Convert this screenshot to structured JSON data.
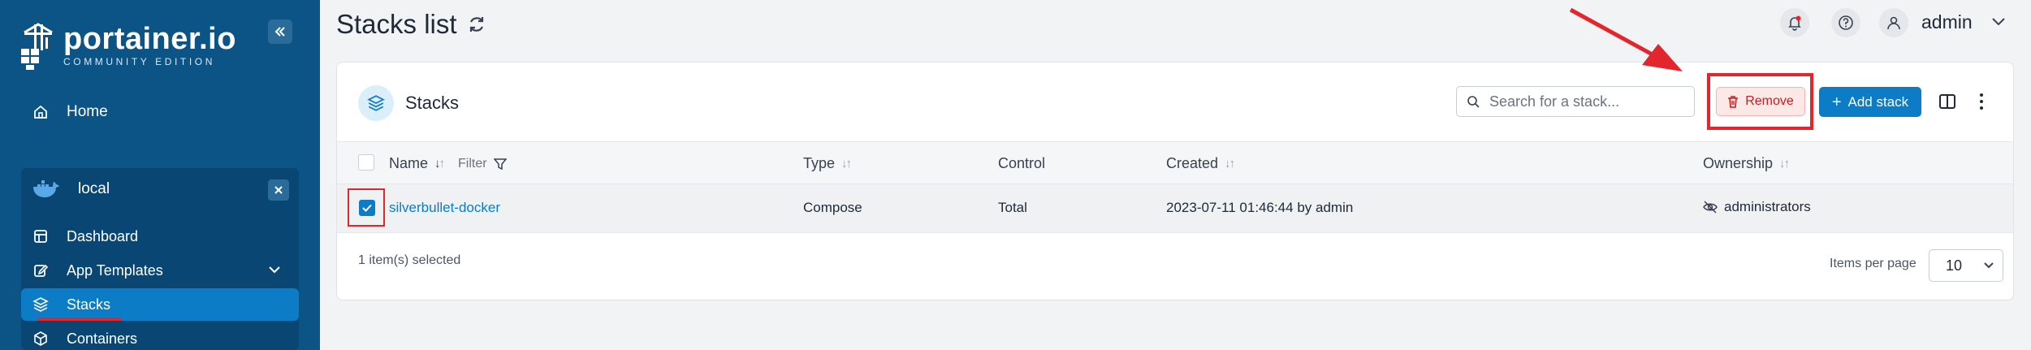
{
  "brand": {
    "name": "portainer.io",
    "edition": "COMMUNITY EDITION"
  },
  "sidebar": {
    "home_label": "Home",
    "environment": {
      "name": "local"
    },
    "items": [
      {
        "label": "Dashboard"
      },
      {
        "label": "App Templates"
      },
      {
        "label": "Stacks"
      },
      {
        "label": "Containers"
      }
    ]
  },
  "header": {
    "title": "Stacks list",
    "user": "admin"
  },
  "card": {
    "title": "Stacks",
    "search_placeholder": "Search for a stack...",
    "remove_label": "Remove",
    "add_label": "Add stack"
  },
  "table": {
    "columns": {
      "name": "Name",
      "filter": "Filter",
      "type": "Type",
      "control": "Control",
      "created": "Created",
      "ownership": "Ownership"
    },
    "rows": [
      {
        "name": "silverbullet-docker",
        "type": "Compose",
        "control": "Total",
        "created": "2023-07-11 01:46:44 by admin",
        "ownership": "administrators"
      }
    ],
    "selected_text": "1 item(s) selected",
    "items_per_page_label": "Items per page",
    "items_per_page": "10"
  },
  "colors": {
    "sidebar_bg": "#0d5486",
    "accent": "#0b7cc5",
    "annotation_red": "#e3262e"
  }
}
